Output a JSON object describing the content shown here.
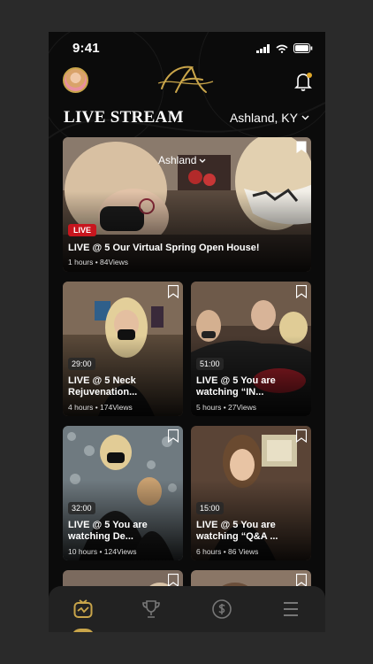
{
  "status": {
    "time": "9:41"
  },
  "header": {
    "title": "LIVE STREAM",
    "location": "Ashland, KY",
    "logo": "script-A-logo"
  },
  "featured": {
    "badge": "LIVE",
    "overlay_location": "Ashland",
    "title": "LIVE @ 5 Our Virtual Spring Open House!",
    "meta": "1 hours  •  84Views"
  },
  "cards": [
    {
      "duration": "29:00",
      "title_line1": "LIVE @ 5 Neck",
      "title_line2": "Rejuvenation...",
      "meta": "4 hours  •  174Views"
    },
    {
      "duration": "51:00",
      "title_line1": "LIVE @ 5 You are",
      "title_line2": "watching “IN...",
      "meta": "5 hours  •  27Views"
    },
    {
      "duration": "32:00",
      "title_line1": "LIVE @ 5 You are",
      "title_line2": "watching De...",
      "meta": "10 hours  •  124Views"
    },
    {
      "duration": "15:00",
      "title_line1": "LIVE @ 5 You are",
      "title_line2": "watching “Q&A ...",
      "meta": "6 hours  •  86 Views"
    }
  ],
  "tabs": [
    "live-tv-icon",
    "trophy-icon",
    "dollar-icon",
    "menu-icon"
  ],
  "colors": {
    "accent": "#c9a54a",
    "live": "#c8161e",
    "background": "#0b0b0b"
  }
}
